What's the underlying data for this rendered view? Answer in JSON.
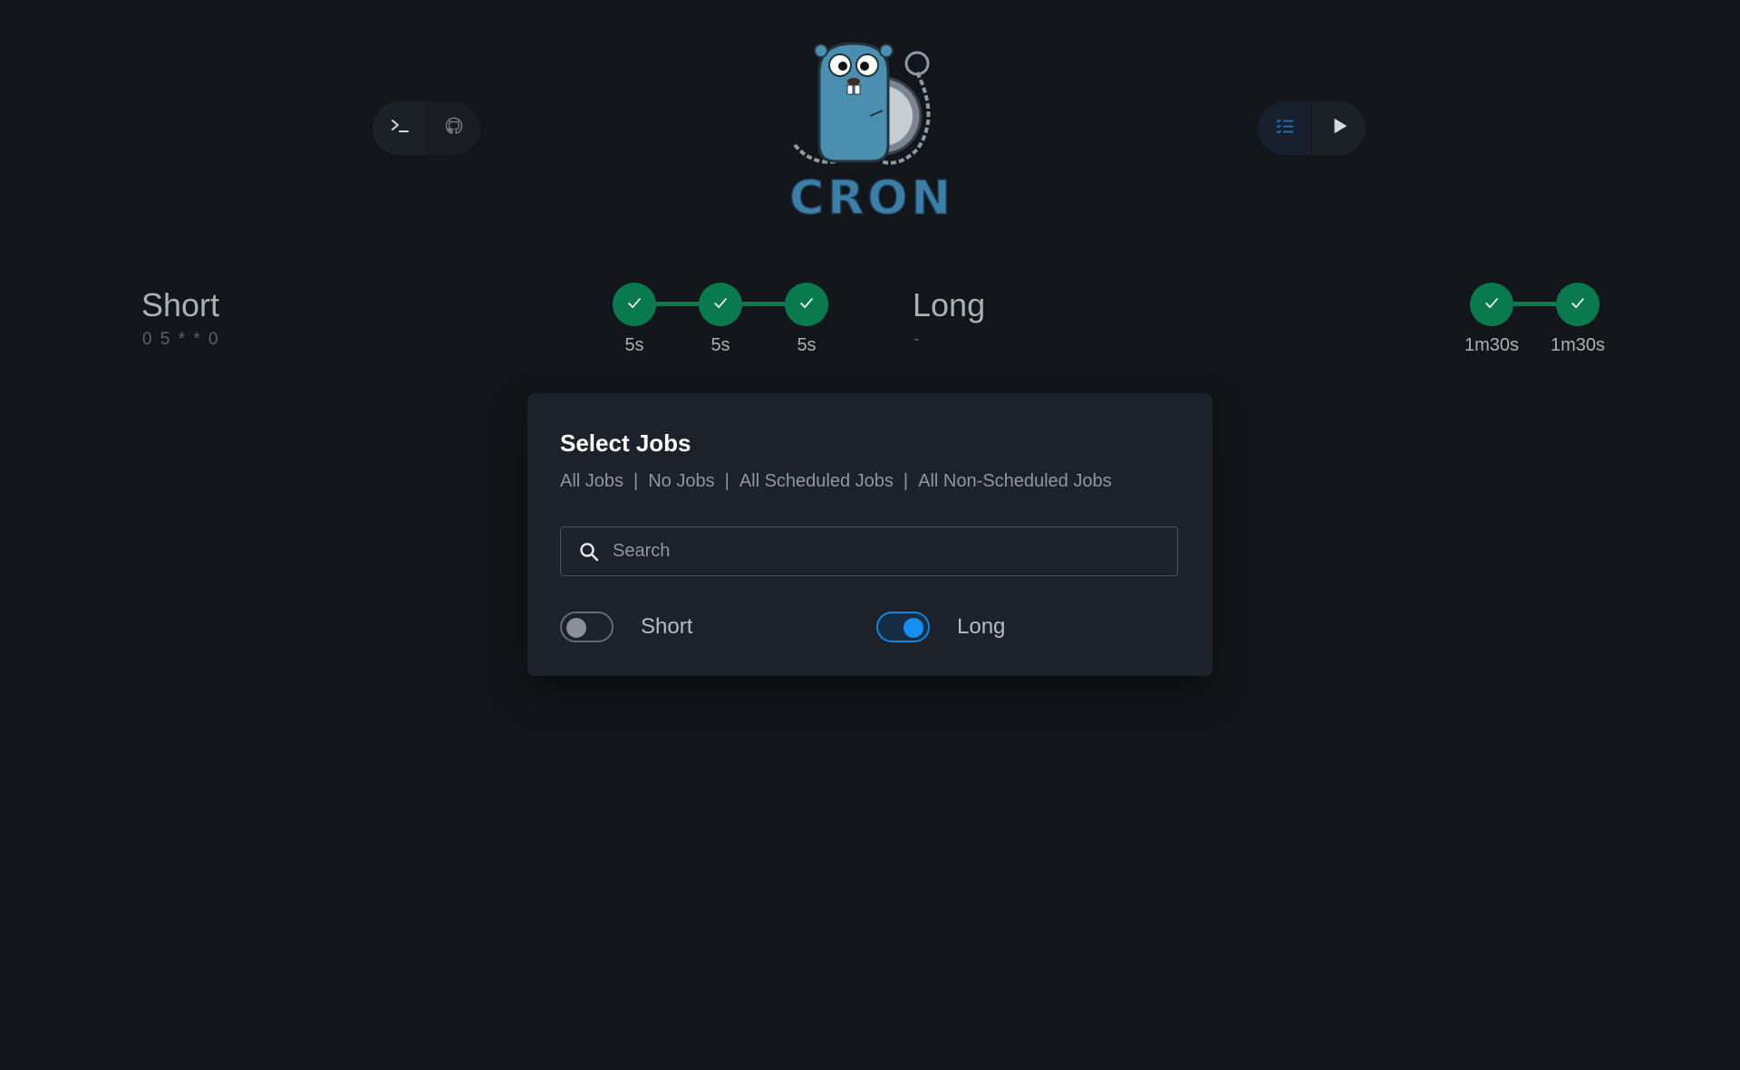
{
  "header": {
    "left_buttons": [
      {
        "icon": "terminal-icon"
      },
      {
        "icon": "github-icon"
      }
    ],
    "logo_text": "CRON",
    "right_buttons": [
      {
        "icon": "checklist-icon"
      },
      {
        "icon": "play-icon"
      }
    ]
  },
  "jobs": [
    {
      "name": "Short",
      "schedule": "0 5 * * 0",
      "runs": [
        {
          "status": "success",
          "duration": "5s"
        },
        {
          "status": "success",
          "duration": "5s"
        },
        {
          "status": "success",
          "duration": "5s"
        }
      ]
    },
    {
      "name": "Long",
      "schedule": "-",
      "runs": [
        {
          "status": "success",
          "duration": "1m30s"
        },
        {
          "status": "success",
          "duration": "1m30s"
        }
      ]
    }
  ],
  "modal": {
    "title": "Select Jobs",
    "links": [
      "All Jobs",
      "No Jobs",
      "All Scheduled Jobs",
      "All Non-Scheduled Jobs"
    ],
    "separator": "|",
    "search_placeholder": "Search",
    "search_value": "",
    "toggles": [
      {
        "label": "Short",
        "checked": false
      },
      {
        "label": "Long",
        "checked": true
      }
    ]
  },
  "colors": {
    "background": "#121519",
    "success": "#087a4d",
    "accent": "#1590f0",
    "modal_bg": "#1c212a"
  }
}
